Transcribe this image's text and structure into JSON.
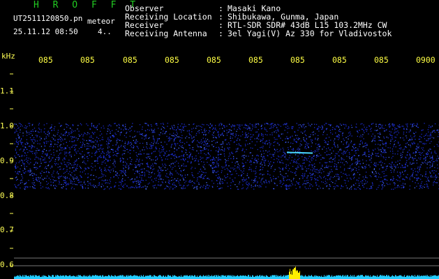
{
  "app": {
    "brand": "H R O F F T",
    "filename": "UT2511120850.pn",
    "meteor_label": "meteor",
    "timestamp": "25.11.12 08:50",
    "count": "4.."
  },
  "header": {
    "colon": ":",
    "rows": [
      {
        "key": "Observer",
        "value": "Masaki Kano"
      },
      {
        "key": "Receiving Location",
        "value": "Shibukawa, Gunma, Japan"
      },
      {
        "key": "Receiver",
        "value": "RTL-SDR SDR# 43dB L15 103.2MHz CW"
      },
      {
        "key": "Receiving Antenna",
        "value": "3el Yagi(V) Az 330 for Vladivostok"
      }
    ]
  },
  "chart_data": {
    "type": "heatmap",
    "ylabel": "kHz",
    "y_ticks": [
      "1.1",
      "1.0",
      "0.9",
      "0.8",
      "0.7",
      "0.6"
    ],
    "x_ticks": [
      "085",
      "085",
      "085",
      "085",
      "085",
      "085",
      "085",
      "085",
      "085",
      "0900"
    ],
    "noise_band_khz": [
      0.82,
      1.01
    ],
    "meteor_trace": {
      "start_khz": 0.925,
      "end_khz": 0.895
    },
    "colors": {
      "background": "#000000",
      "noise": "#1a2bcc",
      "noise_bright": "#4a6bff",
      "trace": "#4ad8ff",
      "axis_text": "#ffff55",
      "grid": "#777777",
      "meter": "#22ccff",
      "meter_peak": "#ffee00"
    }
  }
}
